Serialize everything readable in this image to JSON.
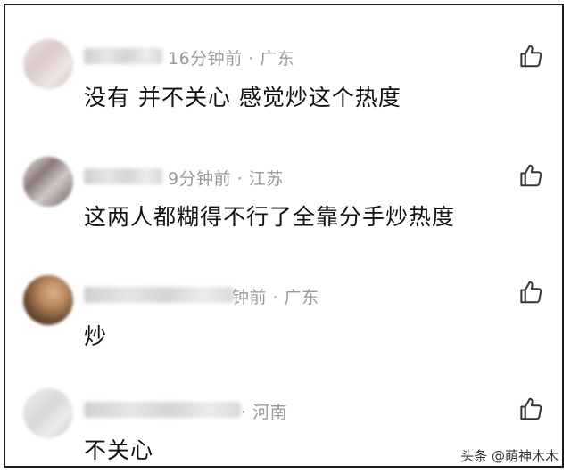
{
  "comments": [
    {
      "meta": "16分钟前 · 广东",
      "text": "没有 并不关心 感觉炒这个热度"
    },
    {
      "meta": "9分钟前 · 江苏",
      "text": "这两人都糊得不行了全靠分手炒热度"
    },
    {
      "meta": "钟前 · 广东",
      "text": "炒"
    },
    {
      "meta": "· 河南",
      "text": "不关心"
    }
  ],
  "watermark": "头条 @萌神木木",
  "colors": {
    "meta_text": "#9a9a9a",
    "content_text": "#111111",
    "icon": "#333333"
  },
  "icons": {
    "like": "thumbs-up-icon"
  }
}
